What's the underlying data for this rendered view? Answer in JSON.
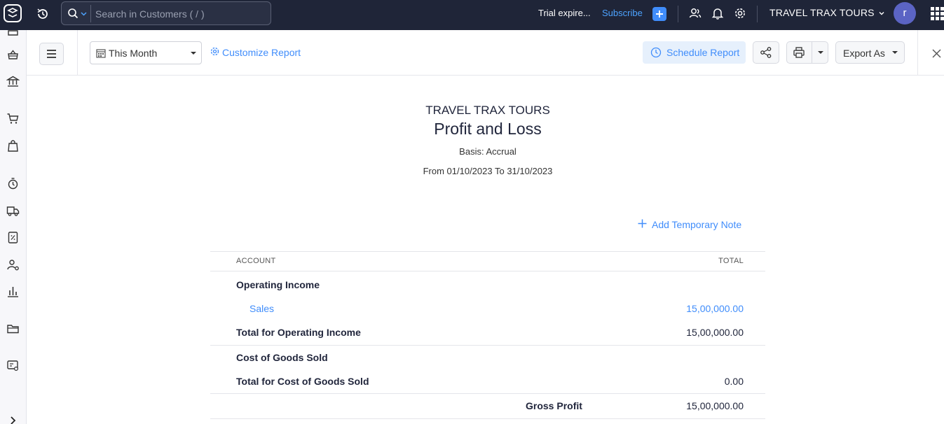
{
  "topbar": {
    "search_placeholder": "Search in Customers ( / )",
    "trial_text": "Trial expire...",
    "subscribe_label": "Subscribe",
    "org_name": "TRAVEL TRAX TOURS",
    "avatar_initial": "r"
  },
  "toolbar": {
    "period_label": "This Month",
    "customize_label": "Customize Report",
    "schedule_label": "Schedule Report",
    "export_label": "Export As"
  },
  "report": {
    "org_name": "TRAVEL TRAX TOURS",
    "title": "Profit and Loss",
    "basis": "Basis: Accrual",
    "range": "From 01/10/2023 To 31/10/2023",
    "add_note_label": "Add Temporary Note",
    "columns": {
      "account": "ACCOUNT",
      "total": "TOTAL"
    },
    "operating_income": {
      "heading": "Operating Income",
      "sales_label": "Sales",
      "sales_value": "15,00,000.00",
      "total_label": "Total for Operating Income",
      "total_value": "15,00,000.00"
    },
    "cogs": {
      "heading": "Cost of Goods Sold",
      "total_label": "Total for Cost of Goods Sold",
      "total_value": "0.00"
    },
    "gross_profit": {
      "label": "Gross Profit",
      "value": "15,00,000.00"
    }
  },
  "colors": {
    "topbar_bg": "#1f2538",
    "accent": "#408dfb",
    "avatar": "#5b64c4"
  },
  "icons": {
    "topbar": [
      "app-logo-icon",
      "recent-icon",
      "search-icon",
      "plus-icon",
      "contacts-icon",
      "bell-icon",
      "gear-icon",
      "apps-grid-icon"
    ],
    "leftnav": [
      "items-icon",
      "banking-icon",
      "sales-cart-icon",
      "purchases-bag-icon",
      "time-tracking-icon",
      "ewaybill-truck-icon",
      "tax-icon",
      "accountant-icon",
      "reports-icon",
      "documents-folder-icon",
      "config-icon",
      "expand-chevron-icon"
    ]
  }
}
